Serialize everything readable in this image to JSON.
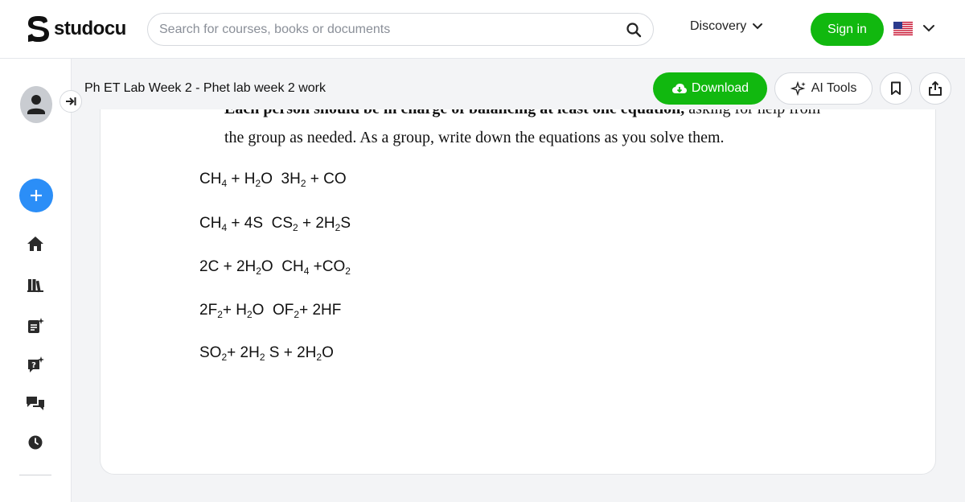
{
  "header": {
    "brand": "studocu",
    "search_placeholder": "Search for courses, books or documents",
    "discovery_label": "Discovery",
    "signin_label": "Sign in"
  },
  "document": {
    "title": "Ph ET Lab Week 2 - Phet lab week 2 work",
    "download_label": "Download",
    "ai_tools_label": "AI Tools"
  },
  "content": {
    "cut_line_bold": "Each person should be in charge of balancing at least one equation,",
    "cut_line_rest": " asking for help from",
    "paragraph_line": "the group as needed. As a group, write down the equations as you solve them.",
    "equations": [
      [
        {
          "t": "CH"
        },
        {
          "s": "4"
        },
        {
          "t": " + H"
        },
        {
          "s": "2"
        },
        {
          "t": "O  3H"
        },
        {
          "s": "2"
        },
        {
          "t": " + CO"
        }
      ],
      [
        {
          "t": "CH"
        },
        {
          "s": "4"
        },
        {
          "t": " + 4S  CS"
        },
        {
          "s": "2"
        },
        {
          "t": " + 2H"
        },
        {
          "s": "2"
        },
        {
          "t": "S"
        }
      ],
      [
        {
          "t": "2C + 2H"
        },
        {
          "s": "2"
        },
        {
          "t": "O  CH"
        },
        {
          "s": "4"
        },
        {
          "t": " +CO"
        },
        {
          "s": "2"
        }
      ],
      [
        {
          "t": "2F"
        },
        {
          "s": "2"
        },
        {
          "t": "+ H"
        },
        {
          "s": "2"
        },
        {
          "t": "O  OF"
        },
        {
          "s": "2"
        },
        {
          "t": "+ 2HF"
        }
      ],
      [
        {
          "t": "SO"
        },
        {
          "s": "2"
        },
        {
          "t": "+ 2H"
        },
        {
          "s": "2"
        },
        {
          "t": " S + 2H"
        },
        {
          "s": "2"
        },
        {
          "t": "O"
        }
      ]
    ]
  },
  "colors": {
    "brand_green": "#11b80f",
    "accent_blue": "#2b8ef7"
  },
  "icons": {
    "search": "search-icon",
    "discovery_chevron": "chevron-down-icon",
    "language": "us-flag-icon",
    "collapse": "collapse-sidebar-icon",
    "add": "plus-icon",
    "home": "home-icon",
    "library": "library-icon",
    "ai_notes": "ai-notes-icon",
    "ai_quiz": "ai-quiz-icon",
    "chat": "chat-icon",
    "recent": "clock-icon",
    "download": "cloud-download-icon",
    "ai_tools": "sparkle-icon",
    "save": "bookmark-icon",
    "share": "share-icon"
  }
}
